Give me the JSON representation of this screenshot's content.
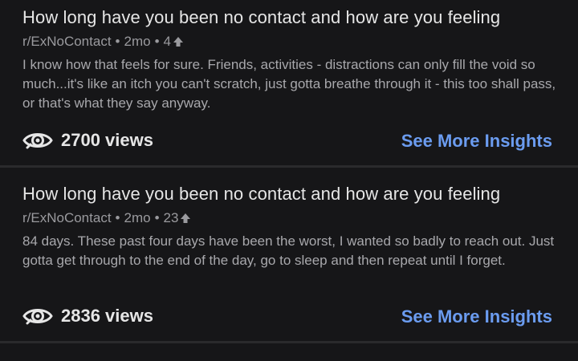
{
  "posts": [
    {
      "title": "How long have you been no contact and how are you feeling",
      "subreddit": "r/ExNoContact",
      "age": "2mo",
      "score": "4",
      "body": "I know how that feels for sure. Friends, activities - distractions can only fill the void so much...it's like an itch you can't scratch, just gotta breathe through it - this too shall pass, or that's what they say anyway.",
      "views": "2700 views",
      "insights_label": "See More Insights"
    },
    {
      "title": "How long have you been no contact and how are you feeling",
      "subreddit": "r/ExNoContact",
      "age": "2mo",
      "score": "23",
      "body": "84 days. These past four days have been the worst, I wanted so badly to reach out. Just gotta get through to the end of the day, go to sleep and then repeat until I forget.",
      "views": "2836 views",
      "insights_label": "See More Insights"
    }
  ],
  "separator": "•",
  "icons": {
    "views": "eye-icon",
    "score": "upvote-arrow-icon"
  },
  "colors": {
    "background": "#161618",
    "link": "#6b9cf0",
    "title": "#e6e6e6",
    "meta": "#9a9a9e"
  }
}
